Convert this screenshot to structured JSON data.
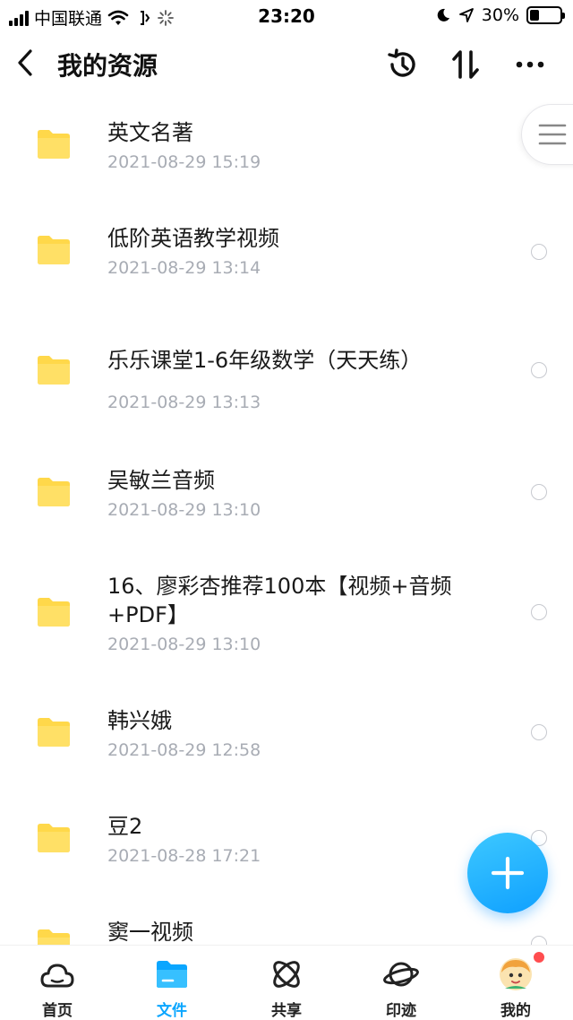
{
  "status_bar": {
    "carrier": "中国联通",
    "time": "23:20",
    "battery_percent": "30%",
    "battery_level": 0.3
  },
  "nav": {
    "title": "我的资源",
    "icons": [
      "back-chevron-icon",
      "history-icon",
      "sort-icon",
      "more-icon"
    ]
  },
  "files": [
    {
      "name": "英文名著",
      "date": "2021-08-29 15:19"
    },
    {
      "name": "低阶英语教学视频",
      "date": "2021-08-29 13:14"
    },
    {
      "name": "乐乐课堂1-6年级数学（天天练）",
      "date": "2021-08-29 13:13"
    },
    {
      "name": "吴敏兰音频",
      "date": "2021-08-29 13:10"
    },
    {
      "name": "16、廖彩杏推荐100本【视频+音频+PDF】",
      "date": "2021-08-29 13:10"
    },
    {
      "name": "韩兴娥",
      "date": "2021-08-29 12:58"
    },
    {
      "name": "豆2",
      "date": "2021-08-28 17:21"
    },
    {
      "name": "窦一视频",
      "date": ""
    }
  ],
  "tabbar": {
    "items": [
      {
        "label": "首页",
        "icon": "cloud-icon"
      },
      {
        "label": "文件",
        "icon": "folder-icon"
      },
      {
        "label": "共享",
        "icon": "atom-icon"
      },
      {
        "label": "印迹",
        "icon": "planet-icon"
      },
      {
        "label": "我的",
        "icon": "avatar-icon"
      }
    ],
    "active": "文件"
  },
  "colors": {
    "accent": "#0aa6ff",
    "folder": "#ffd84a",
    "date_text": "#a8acb4",
    "badge": "#ff4d4f"
  }
}
